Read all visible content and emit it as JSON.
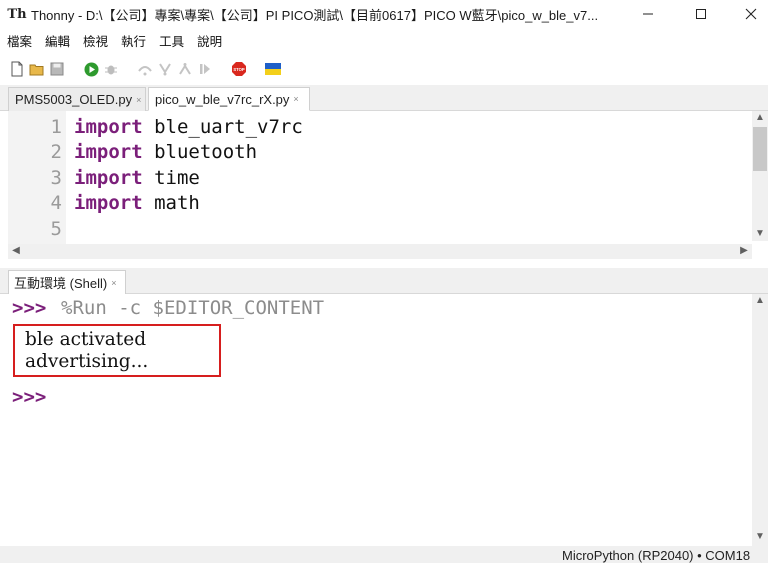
{
  "window": {
    "app_icon": "Th",
    "title": "Thonny  -  D:\\【公司】專案\\專案\\【公司】PI PICO測試\\【目前0617】PICO W藍牙\\pico_w_ble_v7..."
  },
  "menu": [
    "檔案",
    "編輯",
    "檢視",
    "執行",
    "工具",
    "說明"
  ],
  "toolbar": {
    "icons": [
      "new-file-icon",
      "open-folder-icon",
      "save-icon",
      "run-icon",
      "debug-icon",
      "step-over-icon",
      "step-into-icon",
      "step-out-icon",
      "resume-icon",
      "stop-icon",
      "ukraine-flag-icon"
    ],
    "stop_label": "STOP"
  },
  "tabs": [
    {
      "label": "PMS5003_OLED.py",
      "close": "×"
    },
    {
      "label": "pico_w_ble_v7rc_rX.py",
      "close": "×"
    }
  ],
  "editor": {
    "lines": [
      {
        "number": "1",
        "keyword": "import",
        "rest": " ble_uart_v7rc"
      },
      {
        "number": "2",
        "keyword": "import",
        "rest": " bluetooth"
      },
      {
        "number": "3",
        "keyword": "import",
        "rest": " time"
      },
      {
        "number": "4",
        "keyword": "import",
        "rest": " math"
      },
      {
        "number": "5",
        "keyword": "",
        "rest": ""
      }
    ]
  },
  "shell": {
    "tab_label": "互動環境 (Shell)",
    "tab_close": "×",
    "prompt": ">>>",
    "command": "%Run -c $EDITOR_CONTENT",
    "output": [
      "ble activated",
      "advertising..."
    ]
  },
  "status": {
    "interpreter": "MicroPython (RP2040)  •  COM18"
  },
  "colors": {
    "keyword": "#7b1f7a",
    "highlight_box": "#d61e1e",
    "run_green": "#2e9a2e",
    "stop_red": "#d9281e"
  }
}
